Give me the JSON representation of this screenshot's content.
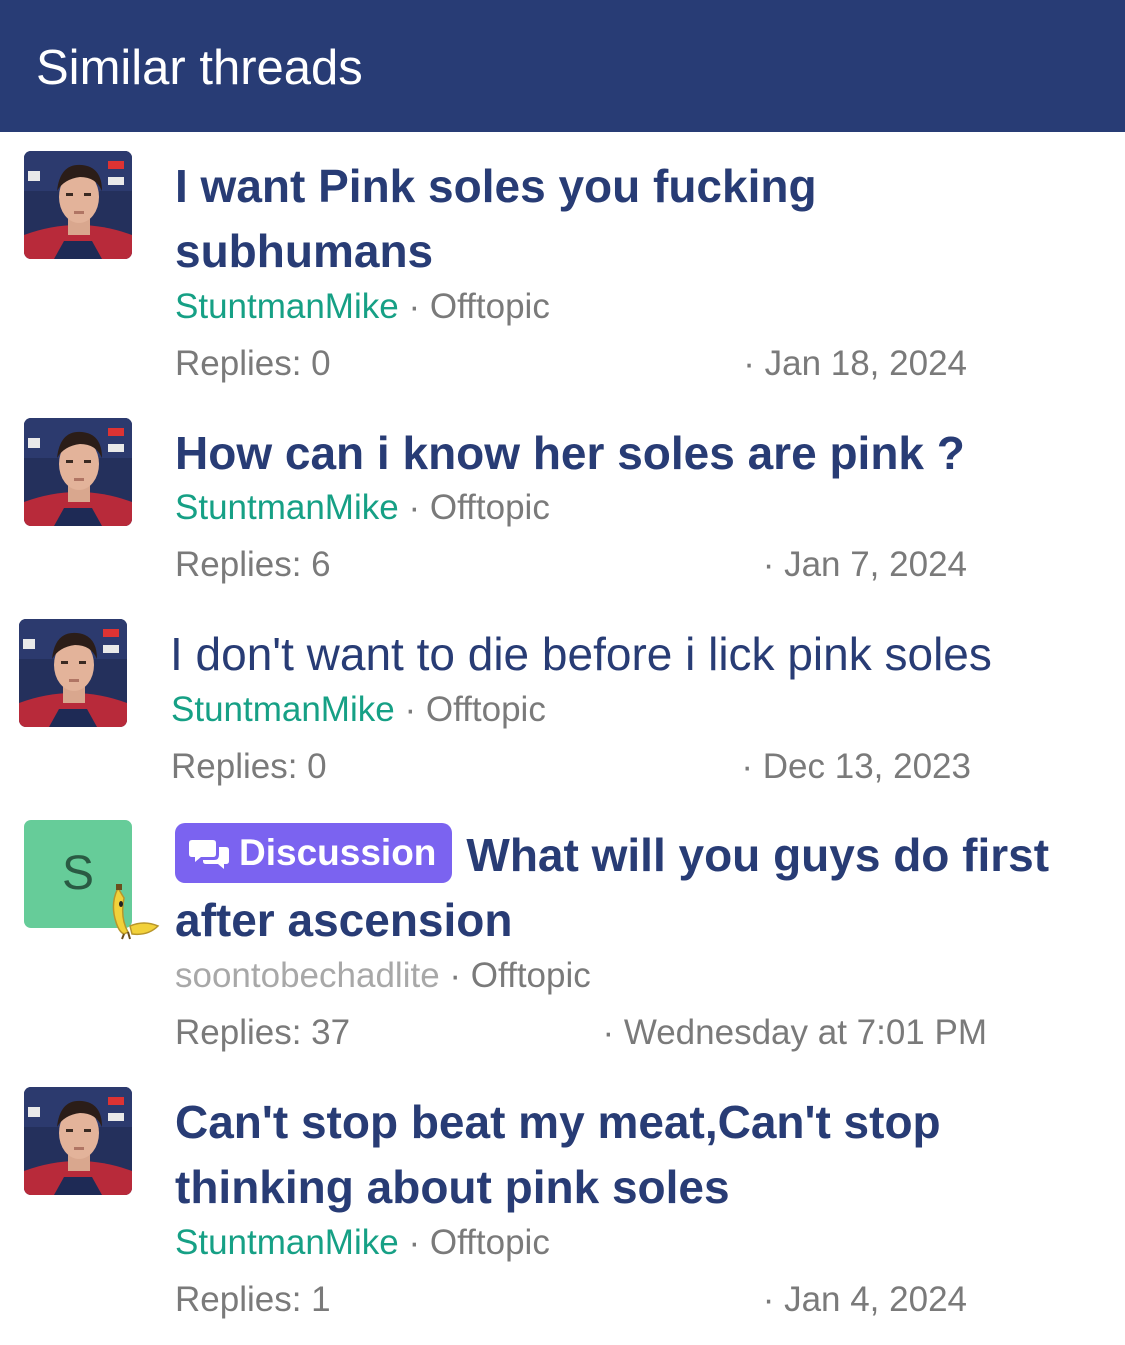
{
  "header": {
    "title": "Similar threads"
  },
  "threads": [
    {
      "title_lines": [
        "I want Pink soles you fucking",
        "subhumans"
      ],
      "author": "StuntmanMike",
      "forum": "Offtopic",
      "replies": "Replies: 0",
      "date": "· Jan 18, 2024",
      "avatar": "photo"
    },
    {
      "title_lines": [
        "How can i know her soles are pink ?"
      ],
      "author": "StuntmanMike",
      "forum": "Offtopic",
      "replies": "Replies: 6",
      "date": "· Jan 7, 2024",
      "avatar": "photo"
    },
    {
      "title_lines": [
        "I don't want to die before i lick pink soles"
      ],
      "author": "StuntmanMike",
      "forum": "Offtopic",
      "replies": "Replies: 0",
      "date": "· Dec 13, 2023",
      "avatar": "photo"
    },
    {
      "prefix_label": "Discussion",
      "title_lines": [
        "What will you guys do first",
        "after ascension"
      ],
      "author": "soontobechadlite",
      "forum": "Offtopic",
      "replies": "Replies: 37",
      "date": "· Wednesday at 7:01 PM",
      "avatar": "letter",
      "avatar_letter": "S",
      "avatar_badge_icon": "banana-icon"
    },
    {
      "title_lines": [
        "Can't stop beat my meat,Can't stop",
        "thinking about pink soles"
      ],
      "author": "StuntmanMike",
      "forum": "Offtopic",
      "replies": "Replies: 1",
      "date": "· Jan 4, 2024",
      "avatar": "photo"
    }
  ],
  "separator": "·",
  "colors": {
    "header_bg": "#283c75",
    "title": "#283c75",
    "author": "#16a085",
    "meta": "#7a7a7a",
    "label_bg": "#7b63f0",
    "letter_avatar_bg": "#66cc99"
  }
}
